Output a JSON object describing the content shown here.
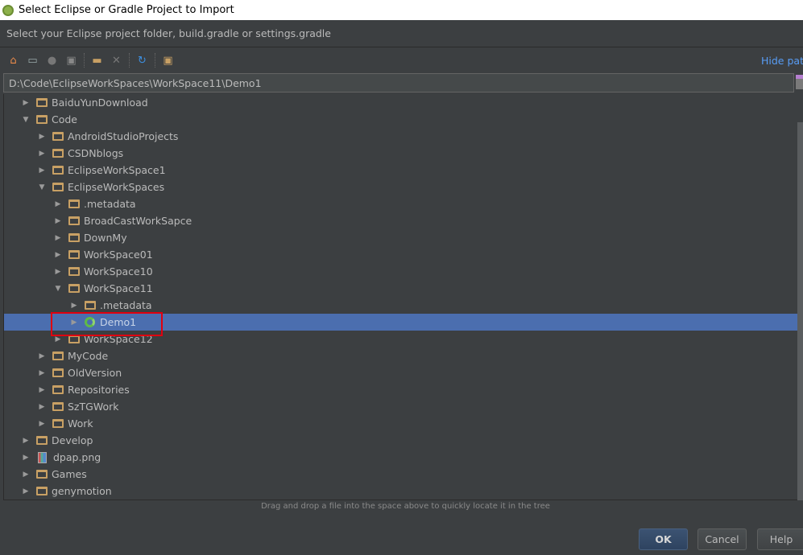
{
  "window": {
    "title": "Select Eclipse or Gradle Project to Import"
  },
  "subtitle": "Select your Eclipse project folder, build.gradle or settings.gradle",
  "toolbar": {
    "icons": [
      "home-icon",
      "desktop-icon",
      "android-icon",
      "module-folder-icon",
      "new-folder-icon",
      "delete-icon",
      "refresh-icon",
      "show-hidden-icon"
    ],
    "hide_path": "Hide path"
  },
  "path": "D:\\Code\\EclipseWorkSpaces\\WorkSpace11\\Demo1",
  "tree": [
    {
      "label": "BaiduYunDownload",
      "level": 0,
      "expanded": false,
      "icon": "folder"
    },
    {
      "label": "Code",
      "level": 0,
      "expanded": true,
      "icon": "folder"
    },
    {
      "label": "AndroidStudioProjects",
      "level": 1,
      "expanded": false,
      "icon": "folder"
    },
    {
      "label": "CSDNblogs",
      "level": 1,
      "expanded": false,
      "icon": "folder"
    },
    {
      "label": "EclipseWorkSpace1",
      "level": 1,
      "expanded": false,
      "icon": "folder"
    },
    {
      "label": "EclipseWorkSpaces",
      "level": 1,
      "expanded": true,
      "icon": "folder"
    },
    {
      "label": ".metadata",
      "level": 2,
      "expanded": false,
      "icon": "folder"
    },
    {
      "label": "BroadCastWorkSapce",
      "level": 2,
      "expanded": false,
      "icon": "folder"
    },
    {
      "label": "DownMy",
      "level": 2,
      "expanded": false,
      "icon": "folder"
    },
    {
      "label": "WorkSpace01",
      "level": 2,
      "expanded": false,
      "icon": "folder"
    },
    {
      "label": "WorkSpace10",
      "level": 2,
      "expanded": false,
      "icon": "folder"
    },
    {
      "label": "WorkSpace11",
      "level": 2,
      "expanded": true,
      "icon": "folder"
    },
    {
      "label": ".metadata",
      "level": 3,
      "expanded": false,
      "icon": "folder"
    },
    {
      "label": "Demo1",
      "level": 3,
      "expanded": false,
      "icon": "project",
      "selected": true
    },
    {
      "label": "WorkSpace12",
      "level": 2,
      "expanded": false,
      "icon": "folder"
    },
    {
      "label": "MyCode",
      "level": 1,
      "expanded": false,
      "icon": "folder"
    },
    {
      "label": "OldVersion",
      "level": 1,
      "expanded": false,
      "icon": "folder"
    },
    {
      "label": "Repositories",
      "level": 1,
      "expanded": false,
      "icon": "folder"
    },
    {
      "label": "SzTGWork",
      "level": 1,
      "expanded": false,
      "icon": "folder"
    },
    {
      "label": "Work",
      "level": 1,
      "expanded": false,
      "icon": "folder"
    },
    {
      "label": "Develop",
      "level": 0,
      "expanded": false,
      "icon": "folder"
    },
    {
      "label": "dpap.png",
      "level": 0,
      "expanded": false,
      "icon": "file"
    },
    {
      "label": "Games",
      "level": 0,
      "expanded": false,
      "icon": "folder"
    },
    {
      "label": "genymotion",
      "level": 0,
      "expanded": false,
      "icon": "folder"
    }
  ],
  "hint": "Drag and drop a file into the space above to quickly locate it in the tree",
  "buttons": {
    "ok": "OK",
    "cancel": "Cancel",
    "help": "Help"
  },
  "colors": {
    "selection": "#4b6eaf",
    "highlight_box": "#e0000f",
    "link": "#589df6"
  }
}
